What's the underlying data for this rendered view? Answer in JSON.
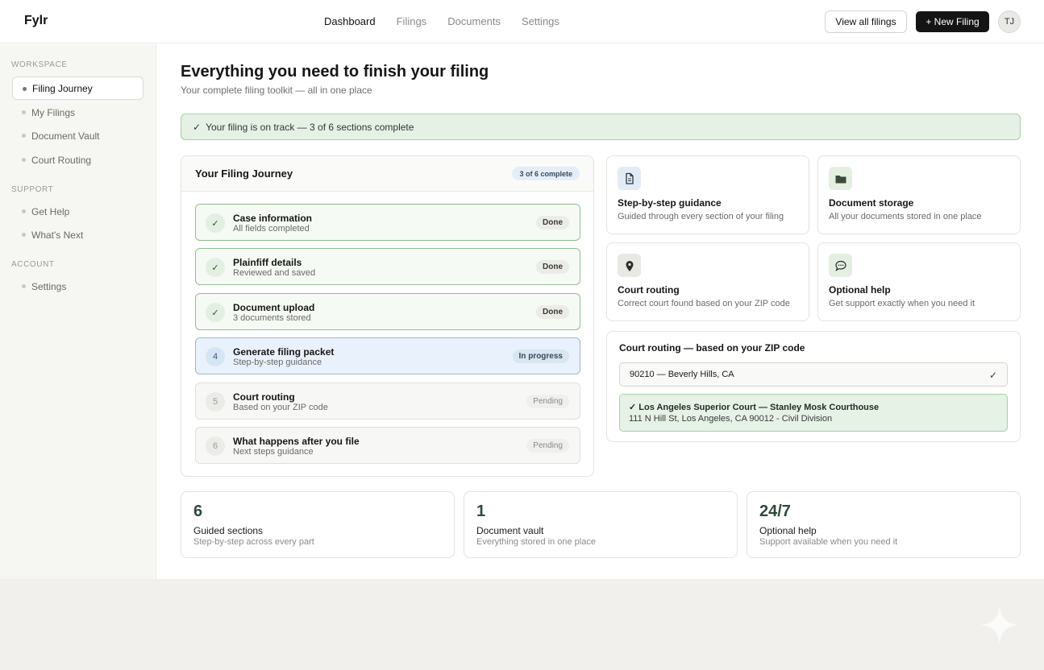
{
  "app": {
    "logo": "Fylr"
  },
  "nav": {
    "items": [
      "Dashboard",
      "Filings",
      "Documents",
      "Settings"
    ]
  },
  "header": {
    "view_all": "View all filings",
    "new_filing": "+ New Filing",
    "avatar": "TJ"
  },
  "sidebar": {
    "sections": [
      {
        "label": "WORKSPACE",
        "items": [
          "Filing Journey",
          "My Filings",
          "Document Vault",
          "Court Routing"
        ]
      },
      {
        "label": "SUPPORT",
        "items": [
          "Get Help",
          "What's Next"
        ]
      },
      {
        "label": "ACCOUNT",
        "items": [
          "Settings"
        ]
      }
    ]
  },
  "page": {
    "title": "Everything you need to finish your filing",
    "subtitle": "Your complete filing toolkit — all in one place",
    "banner": "Your filing is on track — 3 of 6 sections complete",
    "banner_icon": "✓"
  },
  "journey": {
    "title": "Your Filing Journey",
    "badge": "3 of 6 complete",
    "steps": [
      {
        "num": "✓",
        "title": "Case information",
        "sub": "All fields completed",
        "status": "Done"
      },
      {
        "num": "✓",
        "title": "Plainfiff details",
        "sub": "Reviewed and saved",
        "status": "Done"
      },
      {
        "num": "✓",
        "title": "Document upload",
        "sub": "3 documents stored",
        "status": "Done"
      },
      {
        "num": "4",
        "title": "Generate filing packet",
        "sub": "Step-by-step guidance",
        "status": "In progress"
      },
      {
        "num": "5",
        "title": "Court routing",
        "sub": "Based on your ZIP code",
        "status": "Pending"
      },
      {
        "num": "6",
        "title": "What happens after you file",
        "sub": "Next steps guidance",
        "status": "Pending"
      }
    ]
  },
  "features": [
    {
      "title": "Step-by-step guidance",
      "sub": "Guided through every section of your filing"
    },
    {
      "title": "Document storage",
      "sub": "All your documents stored in one place"
    },
    {
      "title": "Court routing",
      "sub": "Correct court found based on your ZIP code"
    },
    {
      "title": "Optional help",
      "sub": "Get support exactly when you need it"
    }
  ],
  "routing": {
    "title": "Court routing — based on your ZIP code",
    "zip_value": "90210 — Beverly Hills, CA",
    "check": "✓",
    "court_name": "✓ Los Angeles Superior Court — Stanley Mosk Courthouse",
    "court_address": "111 N Hill St, Los Angeles, CA 90012 - Civil Division"
  },
  "stats": [
    {
      "num": "6",
      "label": "Guided sections",
      "sub": "Step-by-step across every part"
    },
    {
      "num": "1",
      "label": "Document vault",
      "sub": "Everything stored in one place"
    },
    {
      "num": "24/7",
      "label": "Optional help",
      "sub": "Support available when you need it"
    }
  ],
  "colors": {
    "accent_dark": "#141414",
    "success_bg": "#e4f1e4",
    "success_border": "#a9cfa9",
    "progress_bg": "#e9f2fc"
  }
}
